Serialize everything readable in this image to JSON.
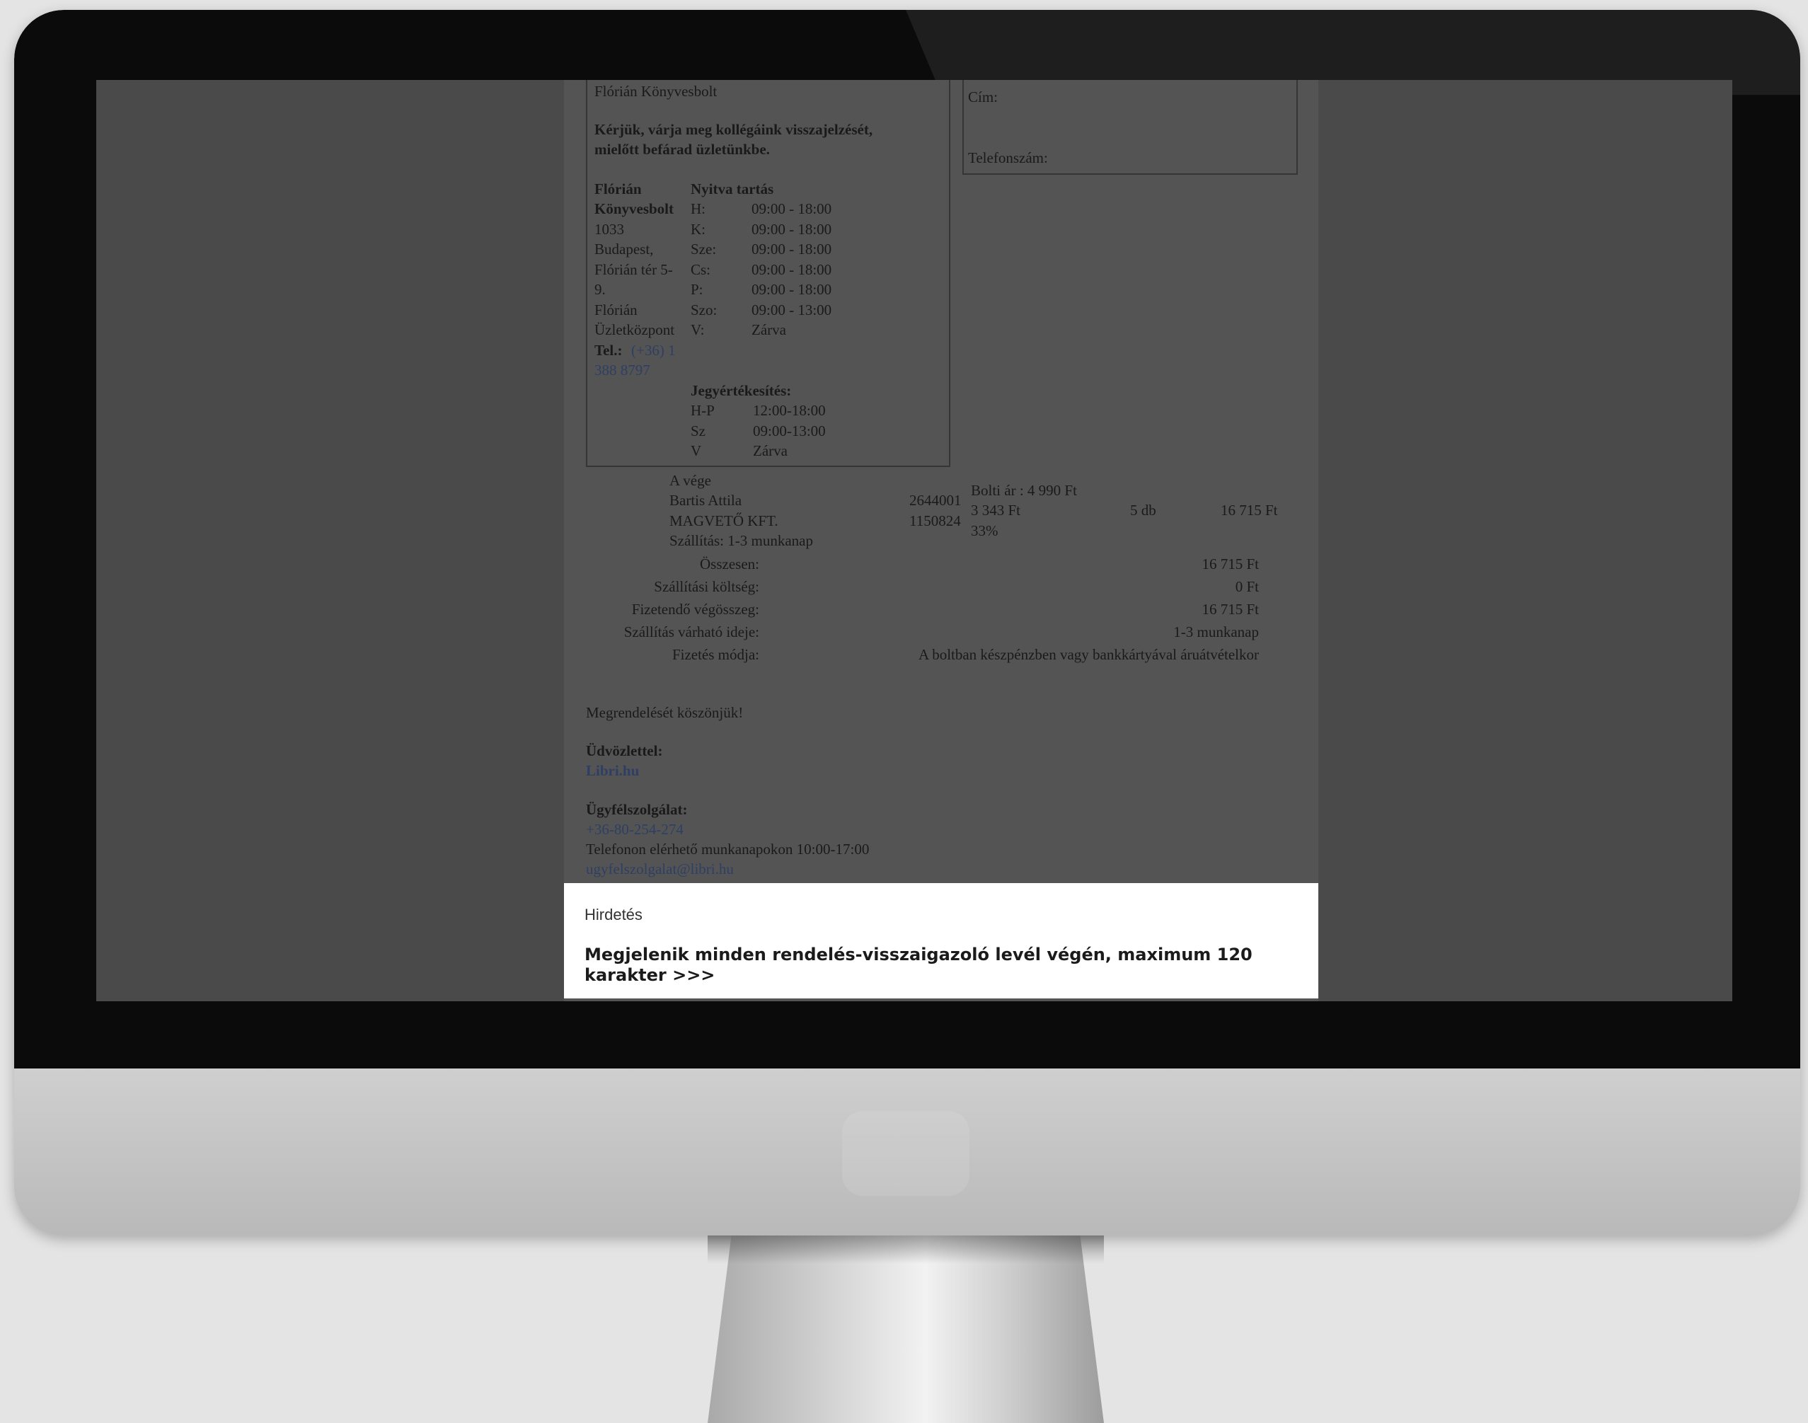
{
  "store": {
    "name_line": "Flórián Könyvesbolt",
    "notice": [
      "Kérjük, várja meg kollégáink visszajelzését,",
      "mielőtt befárad üzletünkbe."
    ],
    "address_lines": [
      "Flórián",
      "Könyvesbolt",
      "1033",
      "Budapest,",
      "Flórián tér 5-",
      "9.",
      "Flórián",
      "Üzletközpont"
    ],
    "tel_label": "Tel.:",
    "tel_value": [
      "(+36) 1",
      "388 8797"
    ],
    "hours_title": "Nyitva tartás",
    "hours": [
      {
        "day": "H:",
        "time": "09:00 - 18:00"
      },
      {
        "day": "K:",
        "time": "09:00 - 18:00"
      },
      {
        "day": "Sze:",
        "time": "09:00 - 18:00"
      },
      {
        "day": "Cs:",
        "time": "09:00 - 18:00"
      },
      {
        "day": "P:",
        "time": "09:00 - 18:00"
      },
      {
        "day": "Szo:",
        "time": "09:00 - 13:00"
      },
      {
        "day": "V:",
        "time": "Zárva"
      }
    ],
    "valuation_title": "Jegyértékesítés:",
    "valuation": [
      {
        "day": "H-P",
        "time": "12:00-18:00"
      },
      {
        "day": "Sz",
        "time": "09:00-13:00"
      },
      {
        "day": "V",
        "time": "Zárva"
      }
    ]
  },
  "contact": {
    "address_label": "Cím:",
    "phone_label": "Telefonszám:"
  },
  "item": {
    "title": "A vége",
    "author": "Bartis Attila",
    "publisher": "MAGVETŐ KFT.",
    "shipping": "Szállítás: 1-3 munkanap",
    "code1": "2644001",
    "code2": "1150824",
    "list_price": "Bolti ár : 4 990 Ft",
    "unit_price": "3 343 Ft",
    "discount": "33%",
    "qty": "5 db",
    "line_total": "16 715 Ft"
  },
  "summary": [
    {
      "label": "Összesen:",
      "value": "16 715 Ft"
    },
    {
      "label": "Szállítási költség:",
      "value": "0 Ft"
    },
    {
      "label": "Fizetendő végösszeg:",
      "value": "16 715 Ft"
    },
    {
      "label": "Szállítás várható ideje:",
      "value": "1-3 munkanap"
    },
    {
      "label": "Fizetés módja:",
      "value": "A boltban készpénzben vagy bankkártyával áruátvételkor"
    }
  ],
  "closing": {
    "thanks": "Megrendelését köszönjük!",
    "regards_label": "Üdvözlettel:",
    "regards_link": "Libri.hu",
    "service_label": "Ügyfélszolgálat:",
    "service_phone": "+36-80-254-274",
    "service_hours": "Telefonon elérhető munkanapokon 10:00-17:00",
    "service_email": "ugyfelszolgalat@libri.hu"
  },
  "ad": {
    "label": "Hirdetés",
    "text_line1": "Megjelenik minden rendelés-visszaigazoló levél végén, maximum 120",
    "text_line2": "karakter >>>"
  }
}
